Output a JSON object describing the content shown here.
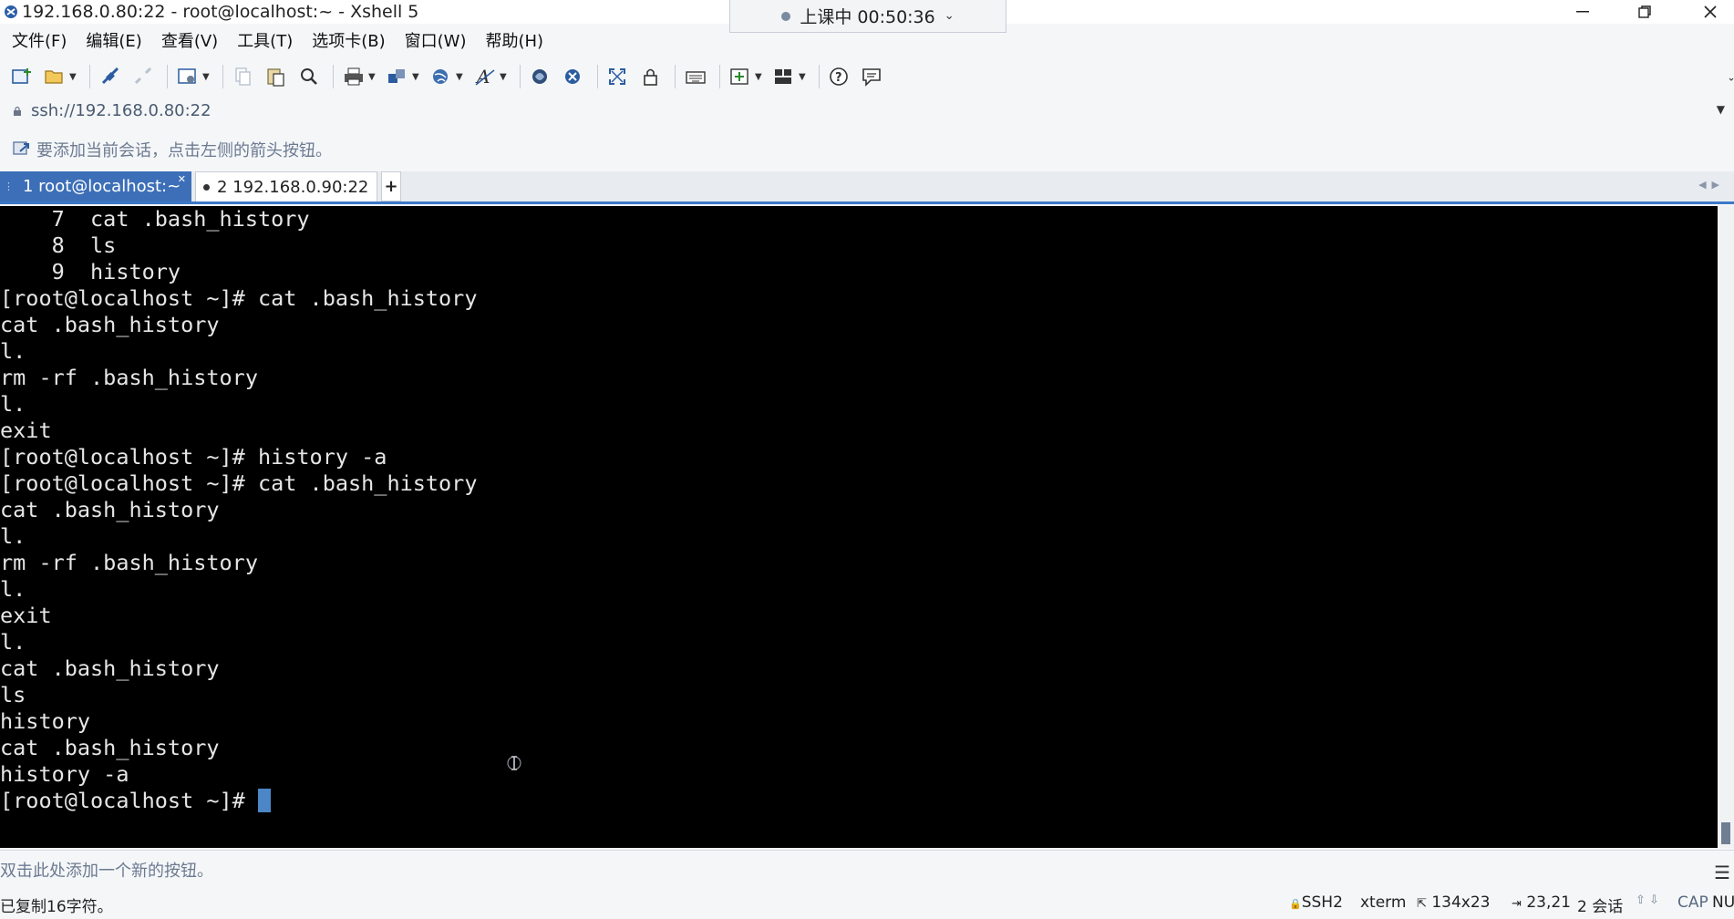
{
  "window": {
    "title": "192.168.0.80:22 - root@localhost:~ - Xshell 5",
    "app_icon": "xshell-icon"
  },
  "class_timer": {
    "label": "上课中 00:50:36"
  },
  "menu": [
    "文件(F)",
    "编辑(E)",
    "查看(V)",
    "工具(T)",
    "选项卡(B)",
    "窗口(W)",
    "帮助(H)"
  ],
  "toolbar": {
    "icons": [
      "new-session-icon",
      "open-folder-icon",
      "connect-icon",
      "disconnect-icon",
      "properties-icon",
      "copy-icon",
      "paste-icon",
      "find-icon",
      "print-icon",
      "transfer-icon",
      "globe-icon",
      "font-icon",
      "xftp-icon",
      "xshell-tunnel-icon",
      "fullscreen-icon",
      "lock-icon",
      "keyboard-icon",
      "compose-icon",
      "layout-icon",
      "help-icon",
      "chat-icon"
    ]
  },
  "address": {
    "url": "ssh://192.168.0.80:22"
  },
  "hint": {
    "text": "要添加当前会话，点击左侧的箭头按钮。"
  },
  "tabs": [
    {
      "label": "1 root@localhost:~",
      "active": true
    },
    {
      "label": "2 192.168.0.90:22",
      "active": false
    }
  ],
  "terminal": {
    "lines": [
      "    7  cat .bash_history",
      "    8  ls",
      "    9  history",
      "[root@localhost ~]# cat .bash_history",
      "cat .bash_history",
      "l.",
      "rm -rf .bash_history",
      "l.",
      "exit",
      "[root@localhost ~]# history -a",
      "[root@localhost ~]# cat .bash_history",
      "cat .bash_history",
      "l.",
      "rm -rf .bash_history",
      "l.",
      "exit",
      "l.",
      "cat .bash_history",
      "ls",
      "history",
      "cat .bash_history",
      "history -a"
    ],
    "prompt": "[root@localhost ~]# "
  },
  "quickbar": {
    "text": "双击此处添加一个新的按钮。"
  },
  "status": {
    "message": "已复制16字符。",
    "protocol": "SSH2",
    "term": "xterm",
    "size": "134x23",
    "cursor_pos": "23,21",
    "sessions": "2 会话",
    "cap": "CAP",
    "num": "NU"
  },
  "colors": {
    "accent": "#3d6fb8",
    "terminal_bg": "#000000",
    "cursor": "#4c86c6"
  }
}
